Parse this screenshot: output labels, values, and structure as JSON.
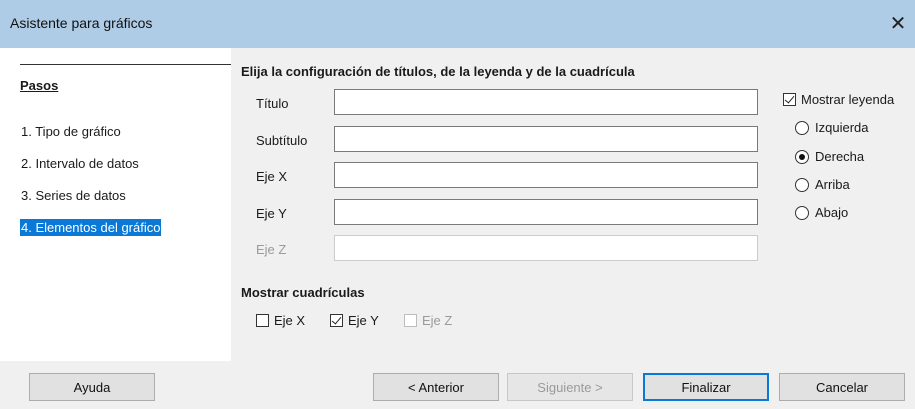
{
  "window": {
    "title": "Asistente para gráficos",
    "close_icon": "close-icon"
  },
  "steps": {
    "heading": "Pasos",
    "items": [
      {
        "label": "1. Tipo de gráfico",
        "active": false
      },
      {
        "label": "2. Intervalo de datos",
        "active": false
      },
      {
        "label": "3. Series de datos",
        "active": false
      },
      {
        "label": "4. Elementos del gráfico",
        "active": true
      }
    ]
  },
  "main": {
    "heading": "Elija la configuración de títulos, de la leyenda y de la cuadrícula",
    "fields": [
      {
        "label": "Título",
        "value": "",
        "enabled": true
      },
      {
        "label": "Subtítulo",
        "value": "",
        "enabled": true
      },
      {
        "label": "Eje X",
        "value": "",
        "enabled": true
      },
      {
        "label": "Eje Y",
        "value": "",
        "enabled": true
      },
      {
        "label": "Eje Z",
        "value": "",
        "enabled": false
      }
    ],
    "legend": {
      "show_label": "Mostrar leyenda",
      "show_checked": true,
      "positions": [
        {
          "label": "Izquierda",
          "selected": false
        },
        {
          "label": "Derecha",
          "selected": true
        },
        {
          "label": "Arriba",
          "selected": false
        },
        {
          "label": "Abajo",
          "selected": false
        }
      ]
    },
    "grids": {
      "heading": "Mostrar cuadrículas",
      "items": [
        {
          "label": "Eje X",
          "checked": false,
          "enabled": true
        },
        {
          "label": "Eje Y",
          "checked": true,
          "enabled": true
        },
        {
          "label": "Eje Z",
          "checked": false,
          "enabled": false
        }
      ]
    }
  },
  "buttons": {
    "help": "Ayuda",
    "back": "< Anterior",
    "next": "Siguiente >",
    "finish": "Finalizar",
    "cancel": "Cancelar"
  },
  "colors": {
    "titlebar": "#aecce6",
    "selection": "#0a78d7",
    "dialog_bg": "#f0f0f0"
  }
}
